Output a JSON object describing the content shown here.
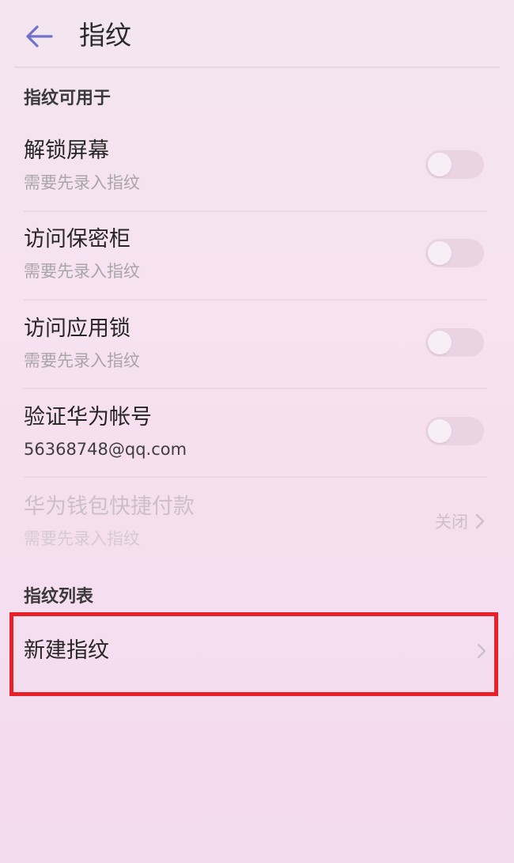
{
  "header": {
    "back_icon": "arrow-left-icon",
    "title": "指纹"
  },
  "section_usage": {
    "label": "指纹可用于",
    "items": [
      {
        "title": "解锁屏幕",
        "subtitle": "需要先录入指纹",
        "toggle_on": false
      },
      {
        "title": "访问保密柜",
        "subtitle": "需要先录入指纹",
        "toggle_on": false
      },
      {
        "title": "访问应用锁",
        "subtitle": "需要先录入指纹",
        "toggle_on": false
      },
      {
        "title": "验证华为帐号",
        "subtitle": "56368748@qq.com",
        "toggle_on": false
      }
    ],
    "wallet": {
      "title": "华为钱包快捷付款",
      "subtitle": "需要先录入指纹",
      "value": "关闭",
      "enabled": false
    }
  },
  "section_list": {
    "label": "指纹列表",
    "new_item": "新建指纹"
  },
  "colors": {
    "accent_back_arrow": "#6f72c8",
    "highlight_border": "#e8202a",
    "background": "#f5e2ef"
  }
}
